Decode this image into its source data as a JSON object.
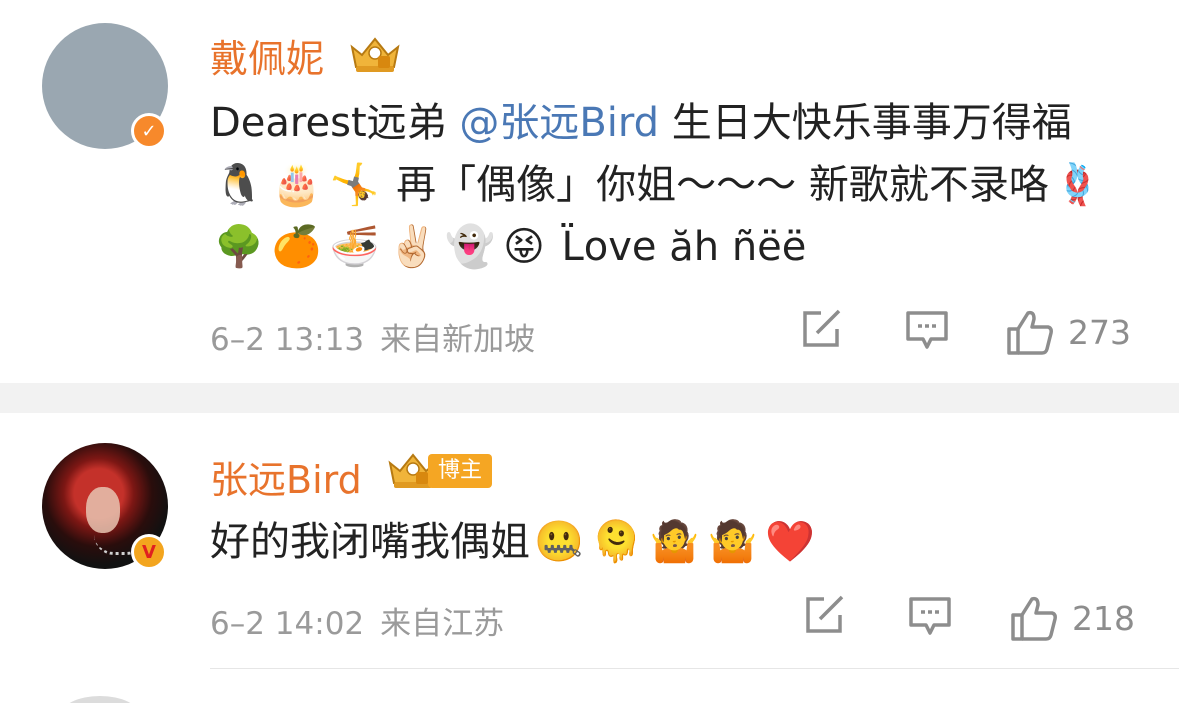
{
  "comments": [
    {
      "author": "戴佩妮",
      "verified_badge": "v-badge",
      "text_parts": {
        "before": "Dearest远弟 ",
        "mention": "@张远Bird",
        "after": " 生日大快乐事事万得福",
        "mid": " 再「偶像」你姐～～～ 新歌就不录咯",
        "tail": " L̈ove ăh ñëë"
      },
      "emojis_a": [
        "🐧",
        "🎂",
        "🤸"
      ],
      "emojis_b": [
        "🪢",
        "🌳",
        "🍊",
        "🍜",
        "✌🏻",
        "👻",
        "😝"
      ],
      "date": "6–2 13:13",
      "location": "来自新加坡",
      "likes": "273"
    },
    {
      "author": "张远Bird",
      "blogger_tag": "博主",
      "text": "好的我闭嘴我偶姐",
      "emojis": [
        "🤐",
        "🫠",
        "🤷",
        "🤷",
        "❤️"
      ],
      "date": "6–2 14:02",
      "location": "来自江苏",
      "likes": "218"
    }
  ],
  "icons": [
    "repost-icon",
    "reply-icon",
    "like-icon",
    "crown-icon"
  ],
  "colors": {
    "name": "#e8732c",
    "mention": "#4a78b5",
    "meta": "#9a9a9a",
    "badge": "#f5a623"
  }
}
